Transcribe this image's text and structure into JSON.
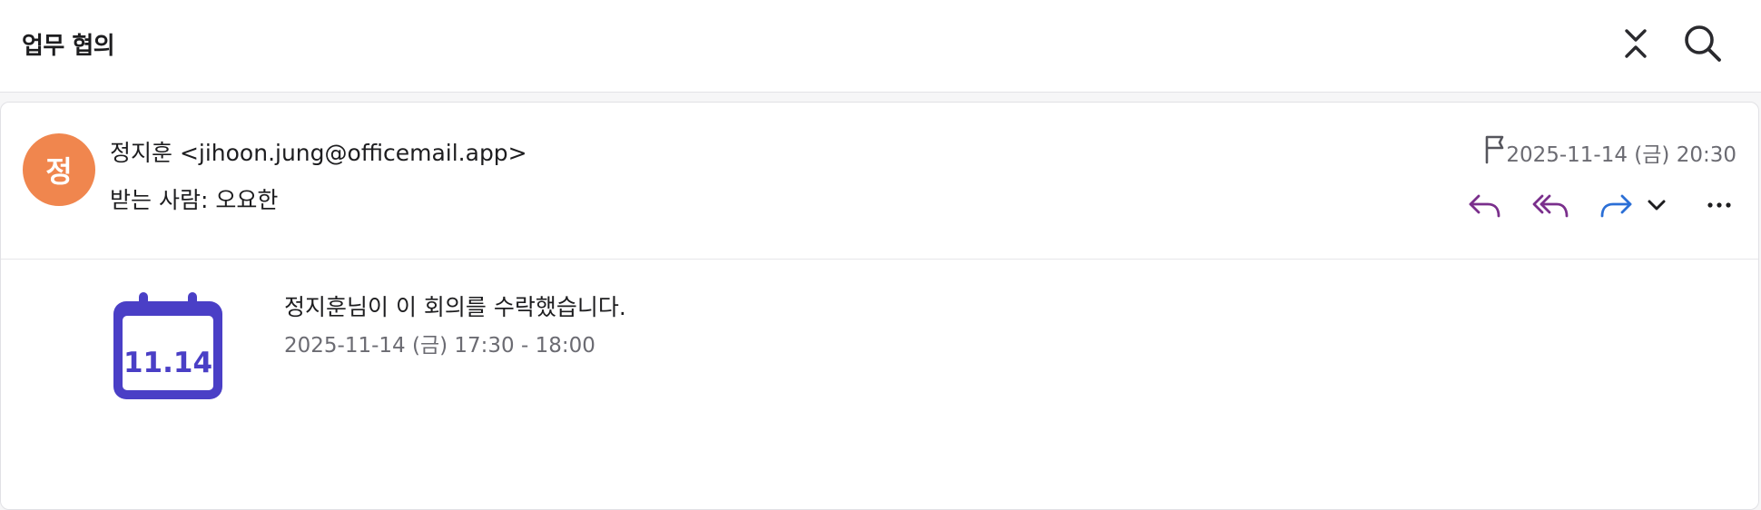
{
  "header": {
    "subject": "업무 협의",
    "collapse_icon": "collapse-icon",
    "search_icon": "search-icon"
  },
  "message": {
    "avatar_initial": "정",
    "avatar_color": "#f0864e",
    "from": "정지훈 <jihoon.jung@officemail.app>",
    "to": "받는 사람: 오요한",
    "date": "2025-11-14 (금) 20:30",
    "actions": [
      "flag-icon",
      "reply-icon",
      "reply-all-icon",
      "forward-icon",
      "chevron-down-icon",
      "more-icon"
    ],
    "colors": {
      "reply": "#7a2f8c",
      "forward": "#2b6fd6"
    }
  },
  "event": {
    "calendar_date": "11.14",
    "calendar_color": "#4a3fc6",
    "title": "정지훈님이 이 회의를 수락했습니다.",
    "time": "2025-11-14 (금) 17:30 - 18:00"
  }
}
